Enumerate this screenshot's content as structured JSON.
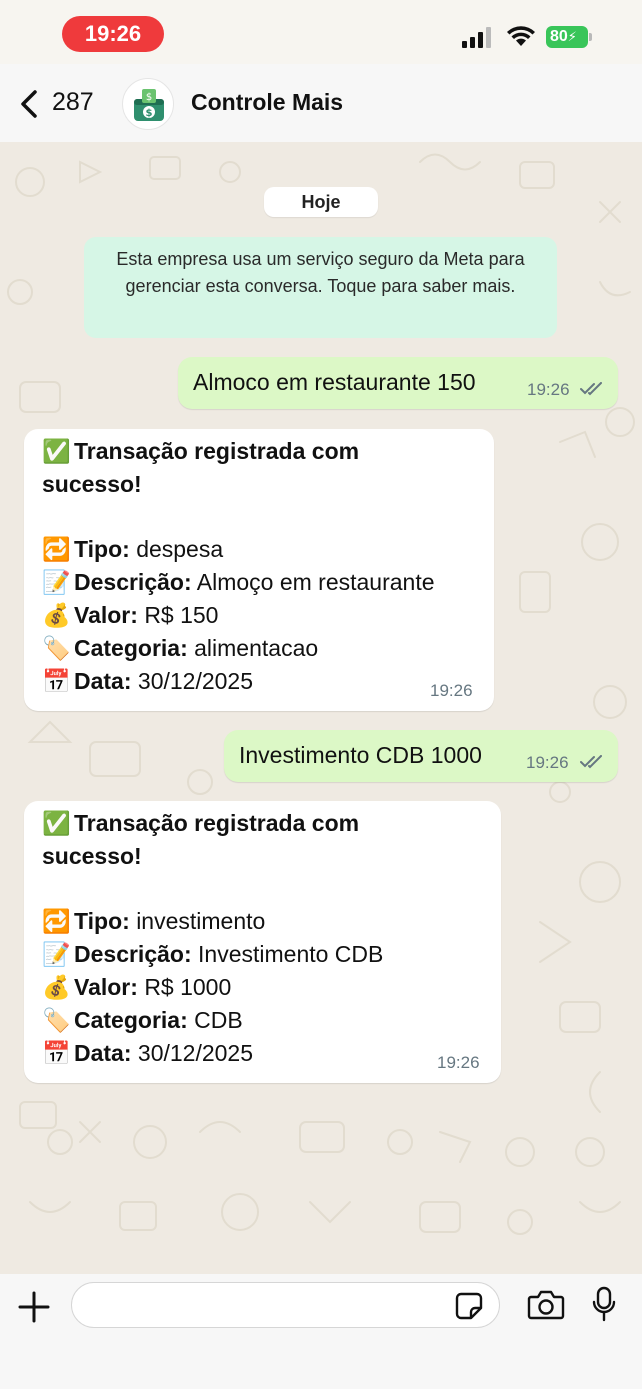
{
  "status_bar": {
    "time": "19:26",
    "battery": "80"
  },
  "header": {
    "back_count": "287",
    "contact_name": "Controle Mais"
  },
  "chat": {
    "date_chip": "Hoje",
    "notice": "Esta empresa usa um serviço seguro da Meta para gerenciar esta conversa. Toque para saber mais.",
    "messages": [
      {
        "direction": "out",
        "text": "Almoco em restaurante 150",
        "time": "19:26"
      },
      {
        "direction": "in",
        "title": "Transação registrada com",
        "title2": "sucesso!",
        "tipo_label": "Tipo:",
        "tipo": "despesa",
        "descricao_label": "Descrição:",
        "descricao": "Almoço em restaurante",
        "valor_label": "Valor:",
        "valor": "R$ 150",
        "categoria_label": "Categoria:",
        "categoria": "alimentacao",
        "data_label": "Data:",
        "data": "30/12/2025",
        "time": "19:26"
      },
      {
        "direction": "out",
        "text": "Investimento CDB 1000",
        "time": "19:26"
      },
      {
        "direction": "in",
        "title": "Transação registrada com",
        "title2": "sucesso!",
        "tipo_label": "Tipo:",
        "tipo": "investimento",
        "descricao_label": "Descrição:",
        "descricao": "Investimento CDB",
        "valor_label": "Valor:",
        "valor": "R$ 1000",
        "categoria_label": "Categoria:",
        "categoria": "CDB",
        "data_label": "Data:",
        "data": "30/12/2025",
        "time": "19:26"
      }
    ]
  },
  "emoji": {
    "check": "✅",
    "repeat": "🔁",
    "memo": "📝",
    "moneybag": "💰",
    "tag": "🏷️",
    "calendar": "📅"
  },
  "composer": {
    "value": "",
    "placeholder": ""
  },
  "colors": {
    "outgoing": "#dcf8c6",
    "incoming": "#ffffff",
    "notice": "#d6f6e6",
    "time_pill": "#ef3a3c",
    "battery": "#39c559",
    "ticks": "#667781"
  }
}
